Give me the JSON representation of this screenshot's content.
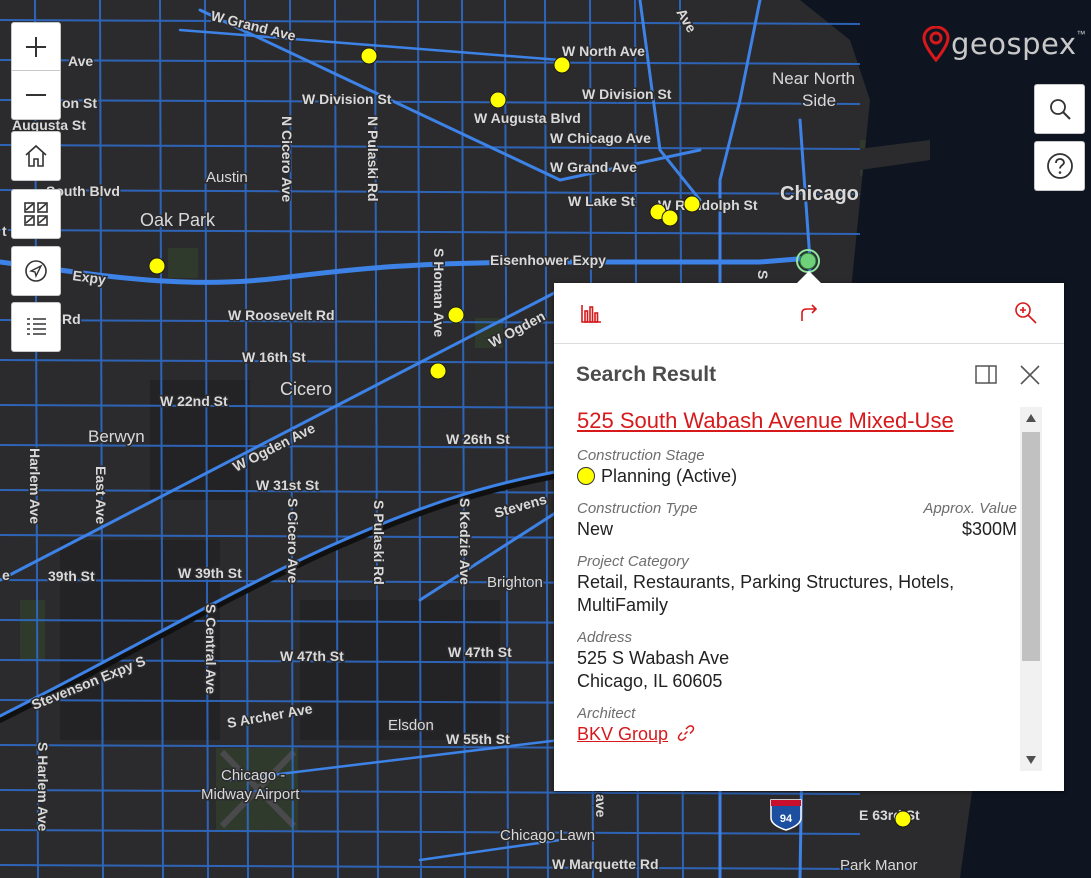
{
  "map": {
    "labels": {
      "w_grand_ave_nw": "W Grand Ave",
      "ave_top_left": "Ave",
      "on_st": "on St",
      "augusta_st_left": "Augusta St",
      "w_division_st": "W Division St",
      "n_cicero_ave": "N Cicero Ave",
      "n_pulaski_rd": "N Pulaski Rd",
      "w_augusta_blvd": "W Augusta Blvd",
      "w_north_ave": "W North Ave",
      "w_division_st_east": "W Division St",
      "w_chicago_ave": "W Chicago Ave",
      "w_grand_ave": "W Grand Ave",
      "w_lake_st": "W Lake St",
      "w_randolph_st": "W Randolph St",
      "near_north_1": "Near North",
      "near_north_2": "Side",
      "chicago": "Chicago",
      "ave_top": "Ave",
      "austin": "Austin",
      "south_blvd": "South Blvd",
      "oak_park": "Oak Park",
      "expy_left": "Expy",
      "eisenhower_expy": "Eisenhower Expy",
      "s_homan_ave": "S Homan Ave",
      "rd_left": "Rd",
      "w_roosevelt_rd": "W Roosevelt Rd",
      "w_ogden_ave_ne": "W Ogden",
      "w_16th_st": "W 16th St",
      "cicero": "Cicero",
      "w_22nd_st": "W 22nd St",
      "berwyn": "Berwyn",
      "w_ogden_ave": "W Ogden Ave",
      "w_26th_st": "W 26th St",
      "harlem_ave": "Harlem Ave",
      "east_ave": "East Ave",
      "w_31st_st": "W 31st St",
      "s_cicero_ave": "S Cicero Ave",
      "s_pulaski_rd": "S Pulaski Rd",
      "s_kedzie_ave": "S Kedzie Ave",
      "stevens": "Stevens",
      "w_39th_st": "39th St",
      "w_39th_st_2": "W 39th St",
      "brighton": "Brighton",
      "s_central_ave": "S Central Ave",
      "stevenson_expy_s": "Stevenson Expy S",
      "w_47th_st": "W 47th St",
      "w_47th_st_2": "W 47th St",
      "s_archer_ave": "S Archer Ave",
      "elsdon": "Elsdon",
      "w_55th_st": "W 55th St",
      "s_harlem_ave": "S Harlem Ave",
      "midway_1": "Chicago -",
      "midway_2": "Midway Airport",
      "chicago_lawn": "Chicago Lawn",
      "w_marquette_rd": "W Marquette Rd",
      "park_manor": "Park Manor",
      "e_63rd_st": "E 63rd St",
      "i94": "94",
      "e_letter": "e",
      "t_letter": "t",
      "s_letter": "S",
      "ave_right": "ave"
    },
    "marker_color": "#ffff00",
    "selected_marker_color": "#6fd17a"
  },
  "controls": {
    "zoom_in": "zoom-in",
    "zoom_out": "zoom-out",
    "home": "home",
    "basemap": "basemap",
    "locate": "locate",
    "legend": "legend"
  },
  "logo": {
    "text": "geospex",
    "tm": "™"
  },
  "popup": {
    "title": "Search Result",
    "project_name": "525 South Wabash Avenue Mixed-Use",
    "construction_stage_label": "Construction Stage",
    "construction_stage_value": "Planning (Active)",
    "construction_type_label": "Construction Type",
    "construction_type_value": "New",
    "approx_value_label": "Approx. Value",
    "approx_value_value": "$300M",
    "project_category_label": "Project Category",
    "project_category_value": "Retail, Restaurants, Parking Structures, Hotels, MultiFamily",
    "address_label": "Address",
    "address_line1": "525 S Wabash Ave",
    "address_line2": "Chicago, IL 60605",
    "architect_label": "Architect",
    "architect_value": "BKV Group"
  },
  "colors": {
    "accent": "#d7191c",
    "road": "#2f6fd0",
    "background": "#2b2b2d"
  }
}
